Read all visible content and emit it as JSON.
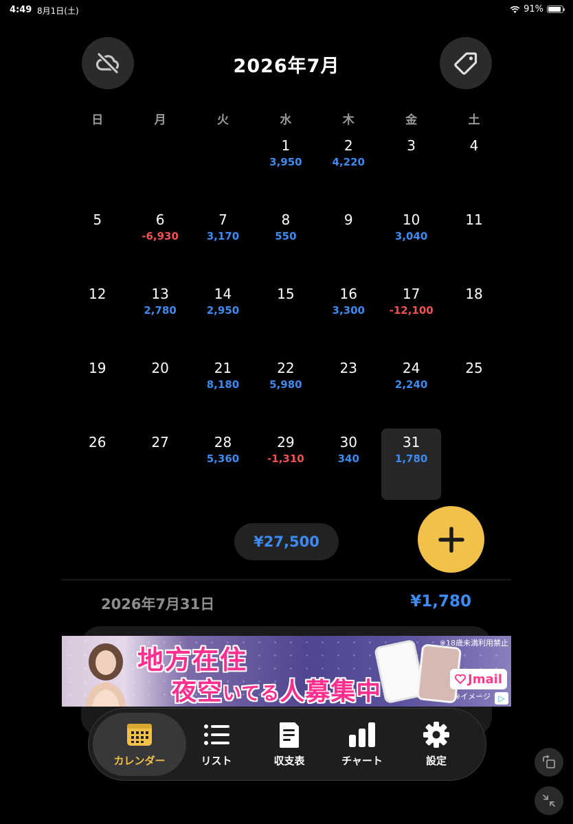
{
  "status_bar": {
    "time": "4:49",
    "date": "8月1日(土)",
    "battery": "91%",
    "battery_level": 0.91
  },
  "header": {
    "title": "2026年7月",
    "left_icon": "cloud-off-icon",
    "right_icon": "tag-icon"
  },
  "weekdays": [
    "日",
    "月",
    "火",
    "水",
    "木",
    "金",
    "土"
  ],
  "calendar": {
    "leading_blanks": 3,
    "selected_day": 31,
    "days": [
      {
        "day": "1",
        "amount": "3,950",
        "type": "pos"
      },
      {
        "day": "2",
        "amount": "4,220",
        "type": "pos"
      },
      {
        "day": "3",
        "amount": "",
        "type": ""
      },
      {
        "day": "4",
        "amount": "",
        "type": ""
      },
      {
        "day": "5",
        "amount": "",
        "type": ""
      },
      {
        "day": "6",
        "amount": "-6,930",
        "type": "neg"
      },
      {
        "day": "7",
        "amount": "3,170",
        "type": "pos"
      },
      {
        "day": "8",
        "amount": "550",
        "type": "pos"
      },
      {
        "day": "9",
        "amount": "",
        "type": ""
      },
      {
        "day": "10",
        "amount": "3,040",
        "type": "pos"
      },
      {
        "day": "11",
        "amount": "",
        "type": ""
      },
      {
        "day": "12",
        "amount": "",
        "type": ""
      },
      {
        "day": "13",
        "amount": "2,780",
        "type": "pos"
      },
      {
        "day": "14",
        "amount": "2,950",
        "type": "pos"
      },
      {
        "day": "15",
        "amount": "",
        "type": ""
      },
      {
        "day": "16",
        "amount": "3,300",
        "type": "pos"
      },
      {
        "day": "17",
        "amount": "-12,100",
        "type": "neg"
      },
      {
        "day": "18",
        "amount": "",
        "type": ""
      },
      {
        "day": "19",
        "amount": "",
        "type": ""
      },
      {
        "day": "20",
        "amount": "",
        "type": ""
      },
      {
        "day": "21",
        "amount": "8,180",
        "type": "pos"
      },
      {
        "day": "22",
        "amount": "5,980",
        "type": "pos"
      },
      {
        "day": "23",
        "amount": "",
        "type": ""
      },
      {
        "day": "24",
        "amount": "2,240",
        "type": "pos"
      },
      {
        "day": "25",
        "amount": "",
        "type": ""
      },
      {
        "day": "26",
        "amount": "",
        "type": ""
      },
      {
        "day": "27",
        "amount": "",
        "type": ""
      },
      {
        "day": "28",
        "amount": "5,360",
        "type": "pos"
      },
      {
        "day": "29",
        "amount": "-1,310",
        "type": "neg"
      },
      {
        "day": "30",
        "amount": "340",
        "type": "pos"
      },
      {
        "day": "31",
        "amount": "1,780",
        "type": "pos"
      }
    ]
  },
  "summary": {
    "total": "¥27,500",
    "add_icon": "plus-icon"
  },
  "day_detail": {
    "date": "2026年7月31日",
    "amount": "¥1,780"
  },
  "ad": {
    "line1": "地方在住",
    "line2_a": "夜空",
    "line2_b": "いてる",
    "line2_c": "人募集中",
    "caption": "※18歳未満利用禁止",
    "brand": "Jmail",
    "note": "※イメージ",
    "choices": "▷"
  },
  "tabs": [
    {
      "label": "カレンダー",
      "icon": "calendar-icon"
    },
    {
      "label": "リスト",
      "icon": "list-icon"
    },
    {
      "label": "収支表",
      "icon": "document-icon"
    },
    {
      "label": "チャート",
      "icon": "bar-chart-icon"
    },
    {
      "label": "設定",
      "icon": "gear-icon"
    }
  ],
  "colors": {
    "accent": "#f2c14a",
    "positive": "#3d8bf0",
    "negative": "#f05252",
    "background": "#000000"
  }
}
